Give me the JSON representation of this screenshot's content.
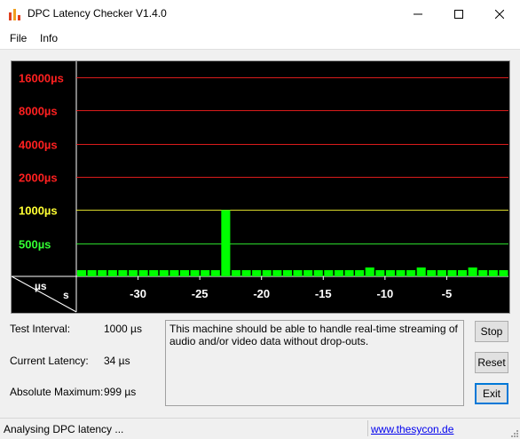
{
  "window": {
    "title": "DPC Latency Checker V1.4.0"
  },
  "menu": [
    "File",
    "Info"
  ],
  "chart_data": {
    "type": "bar",
    "ylabel_scale": [
      "16000µs",
      "8000µs",
      "4000µs",
      "2000µs",
      "1000µs",
      "500µs"
    ],
    "ylabel_colors": [
      "#ff2020",
      "#ff2020",
      "#ff2020",
      "#ff2020",
      "#ffff33",
      "#33ff33"
    ],
    "axis_unit_top": "µs",
    "axis_unit_bottom": "s",
    "x_tick_labels": [
      "-30",
      "-25",
      "-20",
      "-15",
      "-10",
      "-5"
    ],
    "x_ticks": [
      -30,
      -25,
      -20,
      -15,
      -10,
      -5
    ],
    "xlim": [
      -35,
      0
    ],
    "scale": "log",
    "ylim": [
      250,
      22000
    ],
    "bar_color": "#00ff00",
    "values": [
      34,
      34,
      34,
      34,
      34,
      34,
      34,
      34,
      34,
      34,
      34,
      34,
      34,
      34,
      999,
      34,
      34,
      34,
      34,
      34,
      34,
      34,
      34,
      34,
      34,
      34,
      34,
      34,
      60,
      34,
      34,
      34,
      34,
      60,
      34,
      34,
      34,
      34,
      60,
      34,
      34,
      34
    ],
    "bar_heights_note": ""
  },
  "stats": {
    "test_interval_label": "Test Interval:",
    "test_interval_value": "1000 µs",
    "current_latency_label": "Current Latency:",
    "current_latency_value": "34 µs",
    "absolute_maximum_label": "Absolute Maximum:",
    "absolute_maximum_value": "999 µs"
  },
  "message": "This machine should be able to handle real-time streaming of audio and/or video data without drop-outs.",
  "buttons": {
    "stop": "Stop",
    "reset": "Reset",
    "exit": "Exit"
  },
  "status": {
    "text": "Analysing DPC latency ...",
    "link": "www.thesycon.de"
  }
}
